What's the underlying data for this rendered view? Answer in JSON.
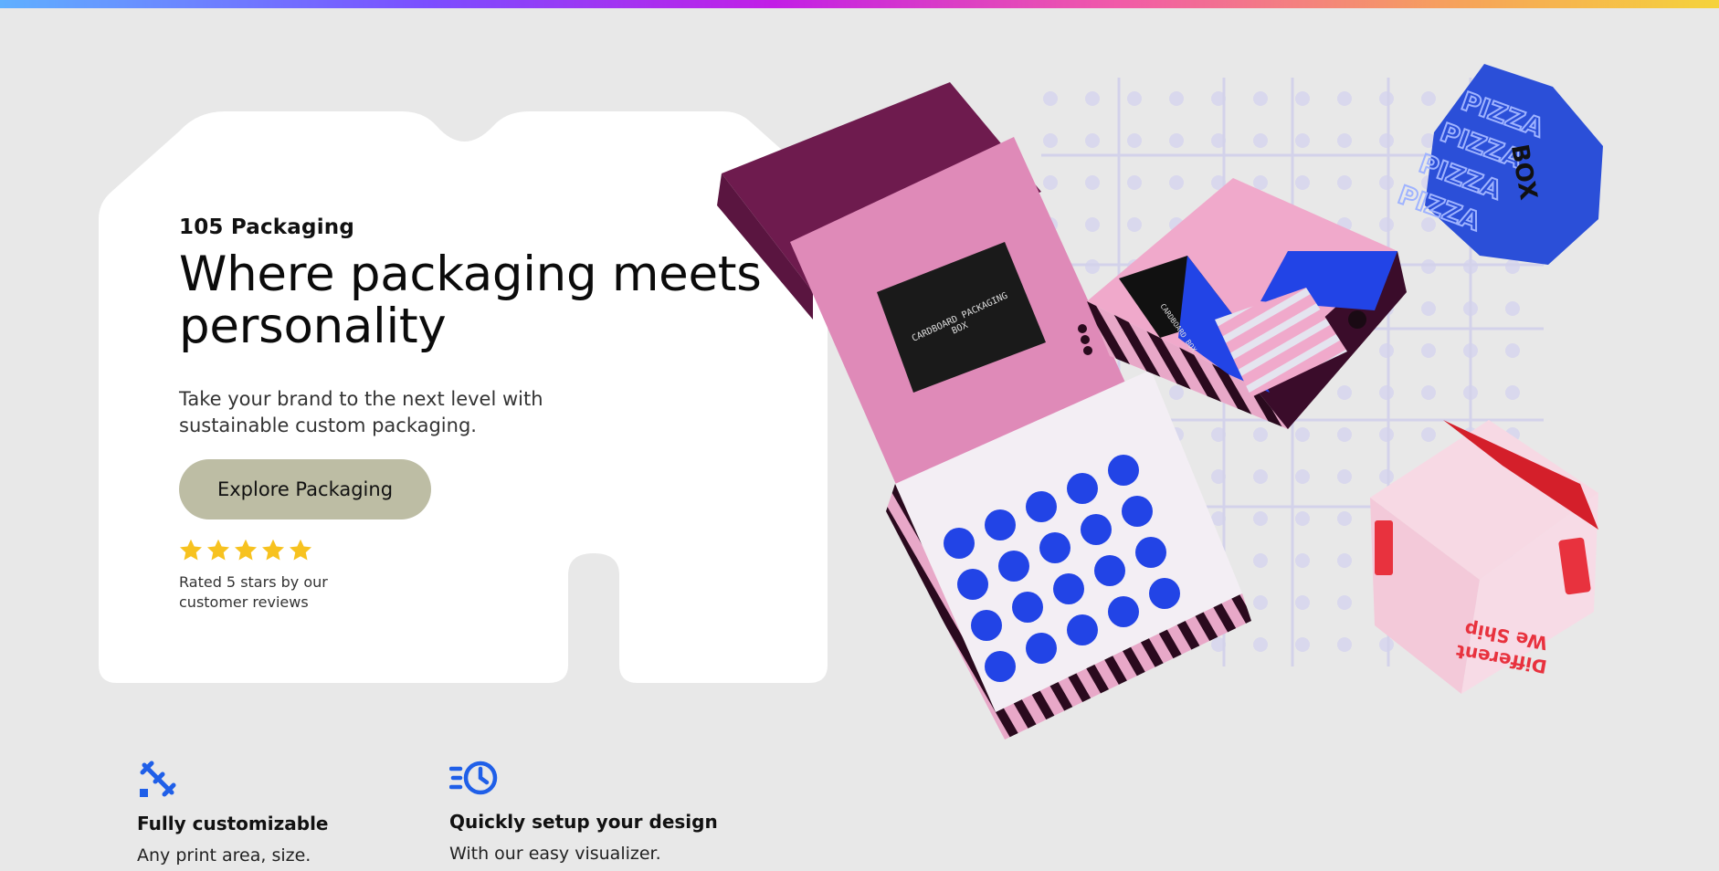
{
  "brand_bar_colors": [
    "#5fb0ff",
    "#7b4dff",
    "#c21ee6",
    "#f15aa8",
    "#f6a35a",
    "#f5d33b"
  ],
  "hero": {
    "eyebrow": "105 Packaging",
    "headline": "Where packaging meets personality",
    "subtext": "Take your brand to the next level with sustainable custom packaging.",
    "cta_label": "Explore Packaging",
    "rating_value": 5,
    "rating_max": 5,
    "rating_text": "Rated 5 stars by our customer reviews",
    "star_color": "#f7c21f",
    "cta_color": "#bdbda4"
  },
  "illustration": {
    "icon": "packaging-boxes-image",
    "texts": [
      "CARDBOARD PACKAGING BOX",
      "PIZZA",
      "BOX",
      "We Ship Different"
    ]
  },
  "features": [
    {
      "icon": "pencil-ruler-icon",
      "title": "Fully customizable",
      "desc": "Any print area, size."
    },
    {
      "icon": "fast-clock-icon",
      "title": "Quickly setup your design",
      "desc": "With our easy visualizer."
    }
  ],
  "accent_color": "#1f5fe8"
}
